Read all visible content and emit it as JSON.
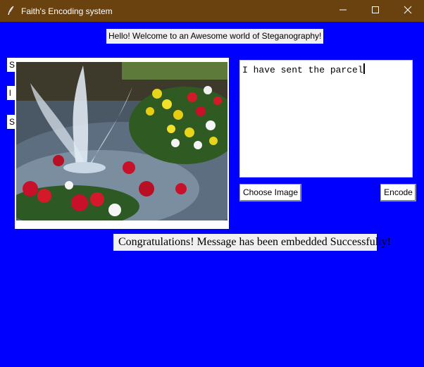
{
  "window": {
    "title": "Faith's Encoding system"
  },
  "welcome_label": "Hello! Welcome to an Awesome world of Steganography!",
  "stub_labels": [
    "S",
    "l",
    "S"
  ],
  "message_text": "I have sent the parcel",
  "buttons": {
    "choose_image": "Choose Image",
    "encode": "Encode"
  },
  "status_label": "Congratulations! Message has been embedded Successfully!",
  "colors": {
    "titlebar": "#6a4210",
    "background": "#0000ff"
  },
  "icons": {
    "app": "feather-icon",
    "minimize": "minimize-icon",
    "maximize": "maximize-icon",
    "close": "close-icon"
  }
}
